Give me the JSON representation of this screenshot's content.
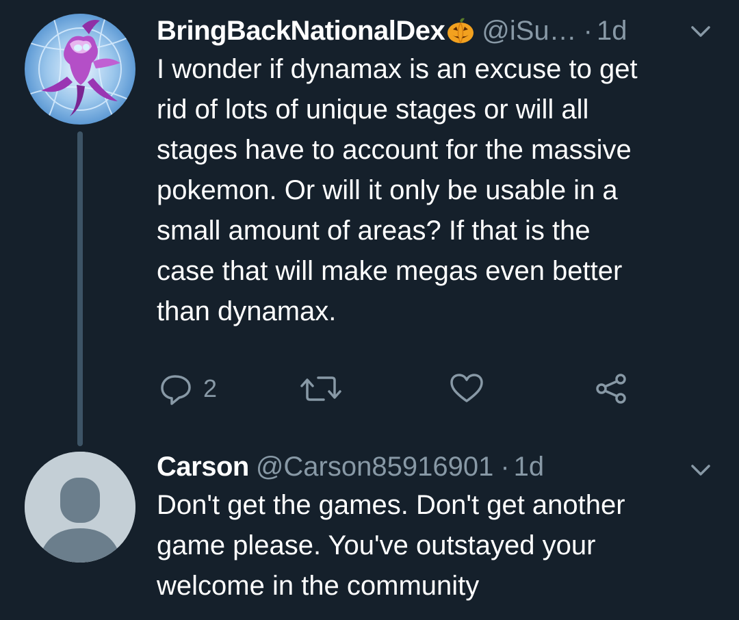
{
  "tweets": [
    {
      "display_name": "BringBackNationalDex",
      "handle": "@iSu…",
      "separator": "·",
      "time": "1d",
      "text": "I wonder if dynamax is an excuse to get\nrid of lots of unique stages or will all\nstages have to account for the massive\npokemon. Or will it only be usable in a\nsmall amount of areas? If that is the\ncase that will make megas even better\nthan dynamax.",
      "reply_count": "2",
      "avatar_icon": "pokemon-character-avatar",
      "emoji_icon": "jack-o-lantern-icon"
    },
    {
      "display_name": "Carson",
      "handle": "@Carson85916901",
      "separator": "·",
      "time": "1d",
      "text": "Don't get the games. Don't get another\ngame please. You've outstayed your\nwelcome in the community",
      "avatar_icon": "default-profile-avatar"
    }
  ],
  "colors": {
    "background": "#15202b",
    "text_primary": "#ffffff",
    "text_secondary": "#8899a6",
    "thread_line": "#3d5466",
    "default_avatar_bg": "#c4cfd6",
    "default_avatar_figure": "#6b7e8c"
  }
}
